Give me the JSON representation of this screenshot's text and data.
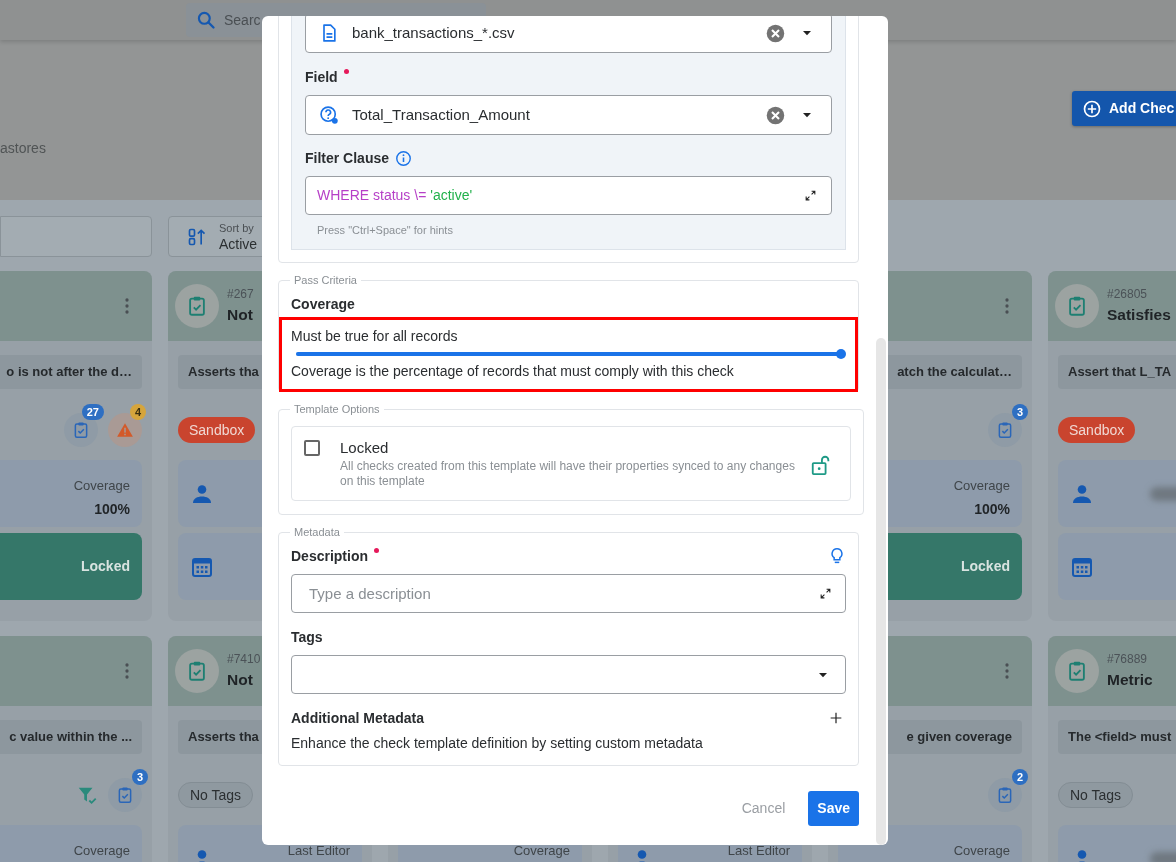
{
  "topbar": {
    "search_placeholder": "Searc"
  },
  "page": {
    "breadcrumb": "astores",
    "add_button": "Add Chec",
    "sort": {
      "label": "Sort by",
      "value": "Active"
    }
  },
  "cards": [
    [
      {
        "menu": true,
        "description": "o is not after the d…",
        "badges": [
          {
            "kind": "checks",
            "count": "27"
          },
          {
            "kind": "alert",
            "count": "4"
          }
        ],
        "panels": [
          {
            "kind": "coverage",
            "label": "Coverage",
            "value": "100%"
          },
          {
            "kind": "locked",
            "label": "Locked"
          }
        ]
      },
      {
        "id": "#267",
        "title": "Not",
        "description": "Asserts tha",
        "tags": [
          {
            "label": "Sandbox",
            "color": "#c9442e"
          }
        ],
        "panels": [
          {
            "kind": "user"
          },
          {
            "kind": "date"
          }
        ]
      },
      {
        "menu": true,
        "description": "atch the calculat…",
        "badges": [
          {
            "kind": "checks",
            "count": "3"
          }
        ],
        "panels": [
          {
            "kind": "coverage",
            "label": "Coverage",
            "value": "100%"
          },
          {
            "kind": "locked",
            "label": "Locked"
          }
        ]
      },
      {
        "id": "#26805",
        "title": "Satisfies",
        "description": "Assert that L_TA",
        "tags": [
          {
            "label": "Sandbox",
            "color": "#c9442e"
          }
        ],
        "panels": [
          {
            "kind": "user"
          },
          {
            "kind": "date"
          }
        ]
      }
    ],
    [
      {
        "menu": true,
        "description": "c value within the ...",
        "badges": [
          {
            "kind": "filter"
          },
          {
            "kind": "checks",
            "count": "3"
          }
        ],
        "panels": [
          {
            "kind": "coverage",
            "label": "Coverage"
          }
        ]
      },
      {
        "id": "#7410",
        "title": "Not",
        "description": "Asserts tha",
        "no_tags": "No Tags",
        "panels": [
          {
            "kind": "user",
            "label": "Last Editor"
          }
        ]
      },
      {
        "panels": [
          {
            "kind": "coverage",
            "label": "Coverage"
          }
        ]
      },
      {
        "panels": [
          {
            "kind": "user",
            "label": "Last Editor"
          }
        ]
      },
      {
        "menu": true,
        "description": "e given coverage",
        "badges": [
          {
            "kind": "checks",
            "count": "2"
          }
        ],
        "panels": [
          {
            "kind": "coverage",
            "label": "Coverage"
          }
        ]
      },
      {
        "id": "#76889",
        "title": "Metric",
        "description": "The <field> must",
        "no_tags": "No Tags",
        "panels": [
          {
            "kind": "user"
          }
        ]
      }
    ]
  ],
  "modal": {
    "container_field": {
      "value": "bank_transactions_*.csv"
    },
    "field": {
      "label": "Field",
      "required": true,
      "value": "Total_Transaction_Amount"
    },
    "filter_clause": {
      "label": "Filter Clause",
      "tokens": [
        {
          "kind": "keyword",
          "text": "WHERE status \\="
        },
        {
          "kind": "string",
          "text": "'active'"
        }
      ],
      "hint": "Press \"Ctrl+Space\" for hints"
    },
    "pass_criteria": {
      "legend": "Pass Criteria",
      "label": "Coverage",
      "caption": "Must be true for all records",
      "level": 1,
      "help": "Coverage is the percentage of records that must comply with this check"
    },
    "template_options": {
      "legend": "Template Options",
      "label": "Locked",
      "checked": false,
      "description": "All checks created from this template will have their properties synced to any changes on this template"
    },
    "metadata": {
      "legend": "Metadata",
      "description": {
        "label": "Description",
        "required": true,
        "placeholder": "Type a description"
      },
      "tags": {
        "label": "Tags",
        "required": false
      },
      "additional": {
        "title": "Additional Metadata",
        "text": "Enhance the check template definition by setting custom metadata"
      }
    },
    "buttons": {
      "cancel": "Cancel",
      "save": "Save"
    }
  }
}
